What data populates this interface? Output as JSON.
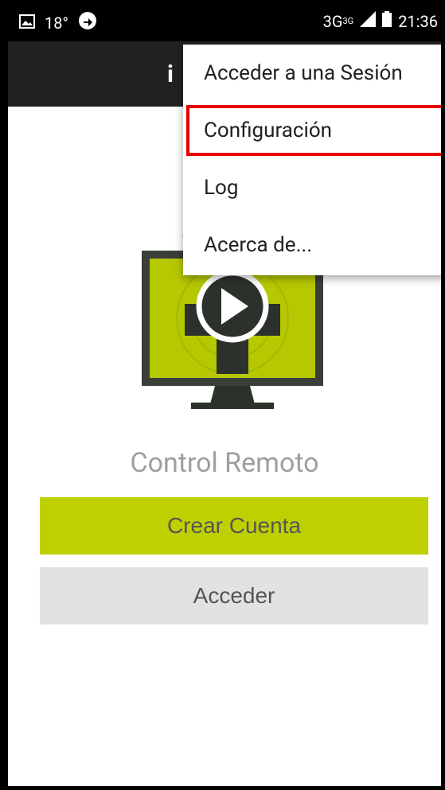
{
  "status_bar": {
    "temperature": "18°",
    "network": "3G",
    "network_sup": "3G",
    "time": "21:36"
  },
  "app_bar": {
    "title": "i"
  },
  "overflow_menu": {
    "items": [
      {
        "label": "Acceder a una Sesión"
      },
      {
        "label": "Configuración",
        "highlighted": true
      },
      {
        "label": "Log"
      },
      {
        "label": "Acerca de..."
      }
    ]
  },
  "main": {
    "title": "Control Remoto",
    "create_account_label": "Crear Cuenta",
    "login_label": "Acceder"
  },
  "colors": {
    "accent": "#bfd000",
    "app_bar": "#212121",
    "secondary_button": "#e2e2e2",
    "highlight": "#e60000"
  }
}
